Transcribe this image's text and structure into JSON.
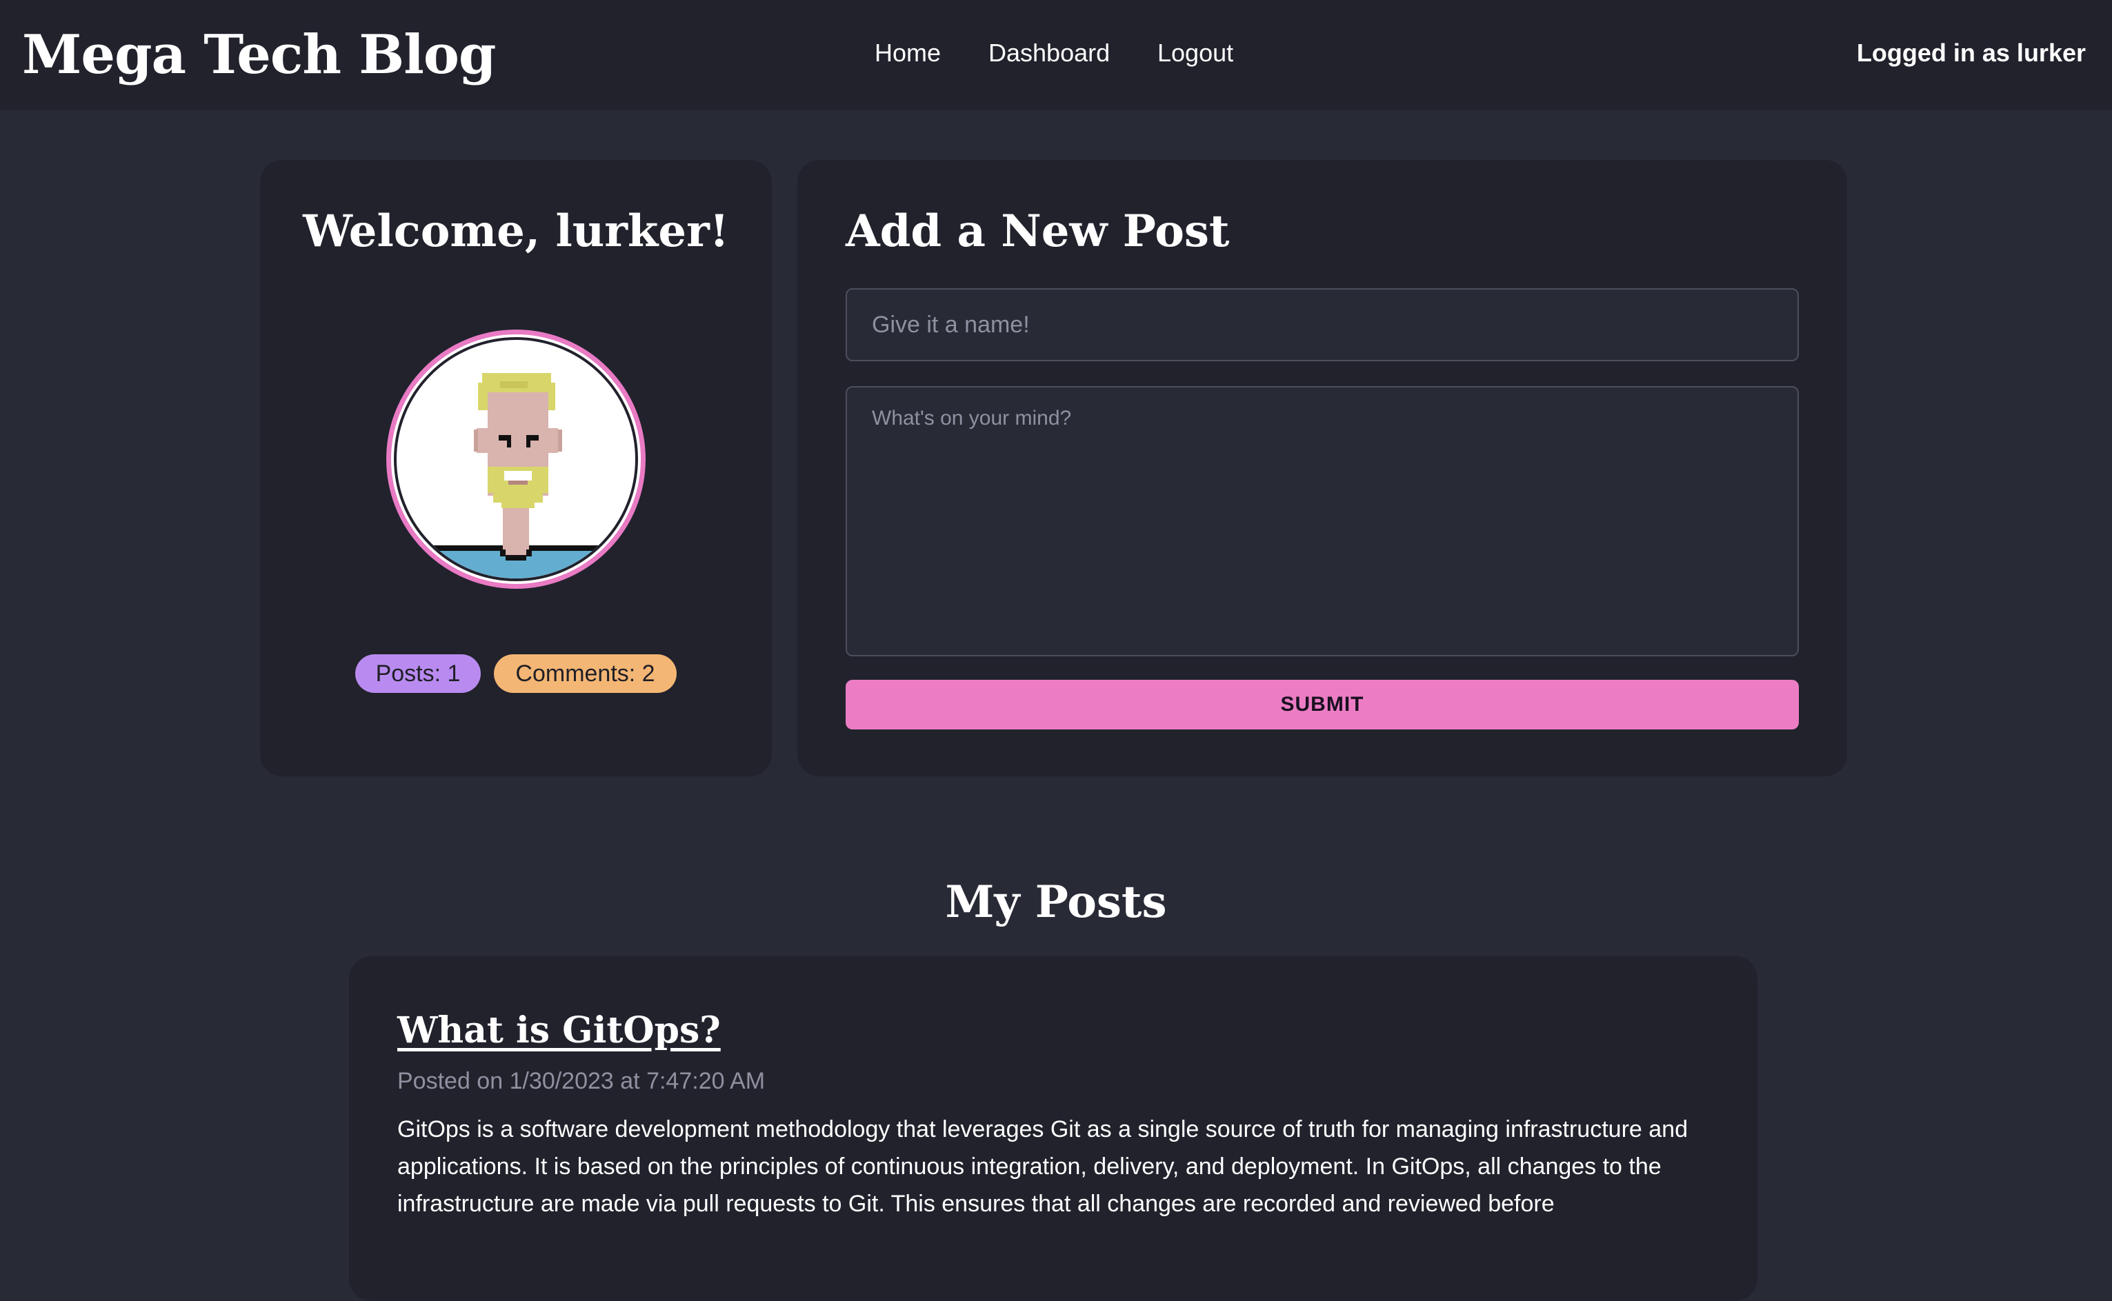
{
  "header": {
    "brand": "Mega Tech Blog",
    "nav": [
      {
        "label": "Home"
      },
      {
        "label": "Dashboard"
      },
      {
        "label": "Logout"
      }
    ],
    "logged_in_text": "Logged in as lurker"
  },
  "welcome": {
    "title": "Welcome, lurker!",
    "avatar_icon": "pixel-avatar-icon",
    "badges": {
      "posts": "Posts: 1",
      "comments": "Comments: 2"
    }
  },
  "new_post": {
    "title": "Add a New Post",
    "name_placeholder": "Give it a name!",
    "name_value": "",
    "body_placeholder": "What's on your mind?",
    "body_value": "",
    "submit_label": "SUBMIT"
  },
  "my_posts": {
    "title": "My Posts",
    "posts": [
      {
        "title": "What is GitOps?",
        "meta": "Posted on 1/30/2023 at 7:47:20 AM",
        "body": "GitOps is a software development methodology that leverages Git as a single source of truth for managing infrastructure and applications. It is based on the principles of continuous integration, delivery, and deployment. In GitOps, all changes to the infrastructure are made via pull requests to Git. This ensures that all changes are recorded and reviewed before"
      }
    ]
  },
  "colors": {
    "background": "#282a36",
    "header": "#21222c",
    "card": "#21222c",
    "accent_pink": "#ec7dc5",
    "badge_posts": "#b98bf0",
    "badge_comments": "#f4b675"
  }
}
